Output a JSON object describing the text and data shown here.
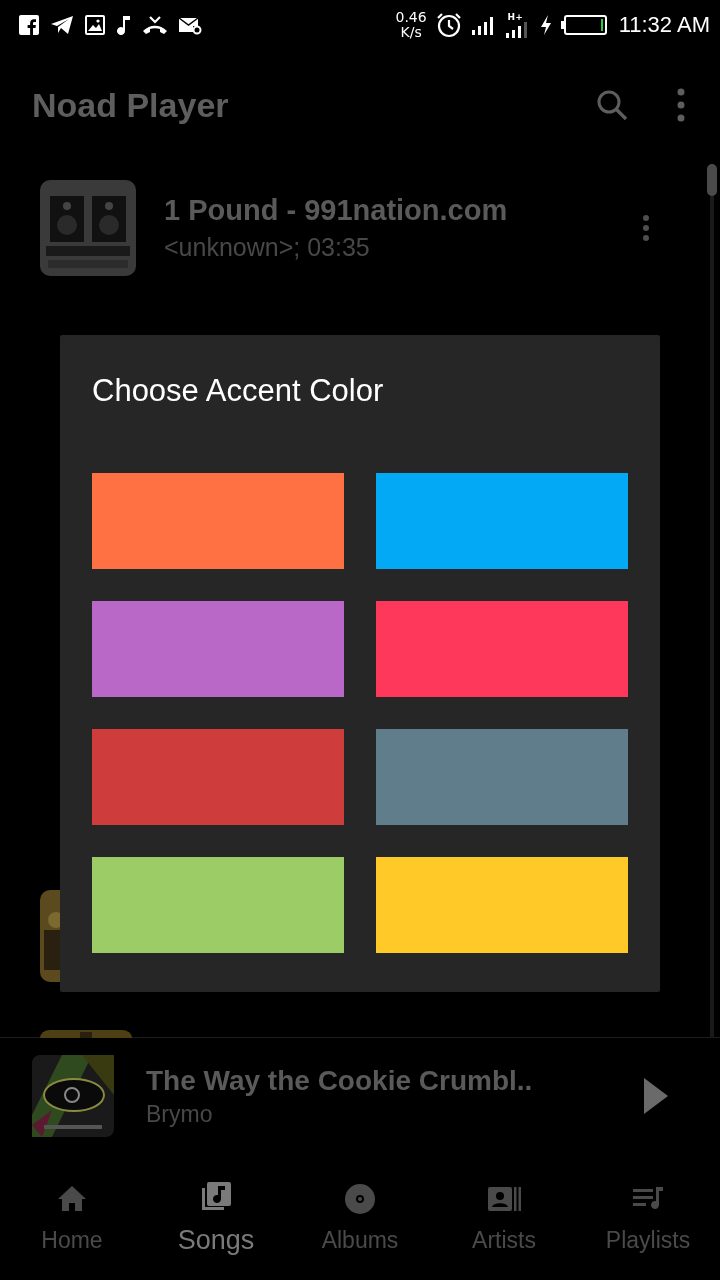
{
  "status_bar": {
    "speed_value": "0.46",
    "speed_unit": "K/s",
    "network_type": "H+",
    "time": "11:32 AM"
  },
  "app_bar": {
    "title": "Noad Player"
  },
  "songs": [
    {
      "title": "1 Pound - 991nation.com",
      "subtitle": "<unknown>; 03:35"
    }
  ],
  "dialog": {
    "title": "Choose Accent Color",
    "swatches": [
      {
        "color": "#ff7043"
      },
      {
        "color": "#03a9f4"
      },
      {
        "color": "#ba68c8"
      },
      {
        "color": "#fe385b"
      },
      {
        "color": "#cf3c3c"
      },
      {
        "color": "#607d8b"
      },
      {
        "color": "#9ccc65"
      },
      {
        "color": "#ffca28"
      }
    ]
  },
  "now_playing": {
    "title": "The Way the Cookie Crumbl..",
    "artist": "Brymo"
  },
  "nav": [
    {
      "label": "Home",
      "selected": false
    },
    {
      "label": "Songs",
      "selected": true
    },
    {
      "label": "Albums",
      "selected": false
    },
    {
      "label": "Artists",
      "selected": false
    },
    {
      "label": "Playlists",
      "selected": false
    }
  ]
}
